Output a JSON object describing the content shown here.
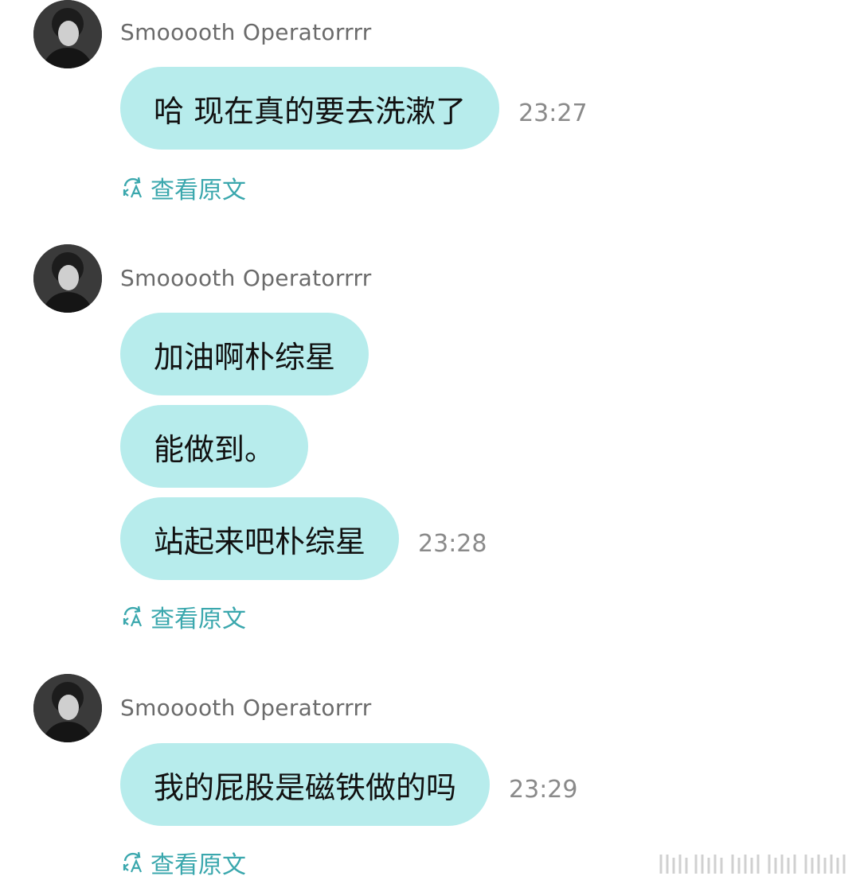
{
  "accent_color": "#3aa7ad",
  "bubble_color": "#b7ecec",
  "groups": [
    {
      "sender": "Smooooth Operatorrrr",
      "messages": [
        {
          "text": "哈 现在真的要去洗漱了",
          "time": "23:27"
        }
      ],
      "view_original": "查看原文",
      "view_original_icon": "translate-refresh-icon"
    },
    {
      "sender": "Smooooth Operatorrrr",
      "messages": [
        {
          "text": "加油啊朴综星",
          "time": ""
        },
        {
          "text": "能做到。",
          "time": ""
        },
        {
          "text": "站起来吧朴综星",
          "time": "23:28"
        }
      ],
      "view_original": "查看原文",
      "view_original_icon": "translate-refresh-icon"
    },
    {
      "sender": "Smooooth Operatorrrr",
      "messages": [
        {
          "text": "我的屁股是磁铁做的吗",
          "time": "23:29"
        }
      ],
      "view_original": "查看原文",
      "view_original_icon": "translate-refresh-icon"
    }
  ]
}
